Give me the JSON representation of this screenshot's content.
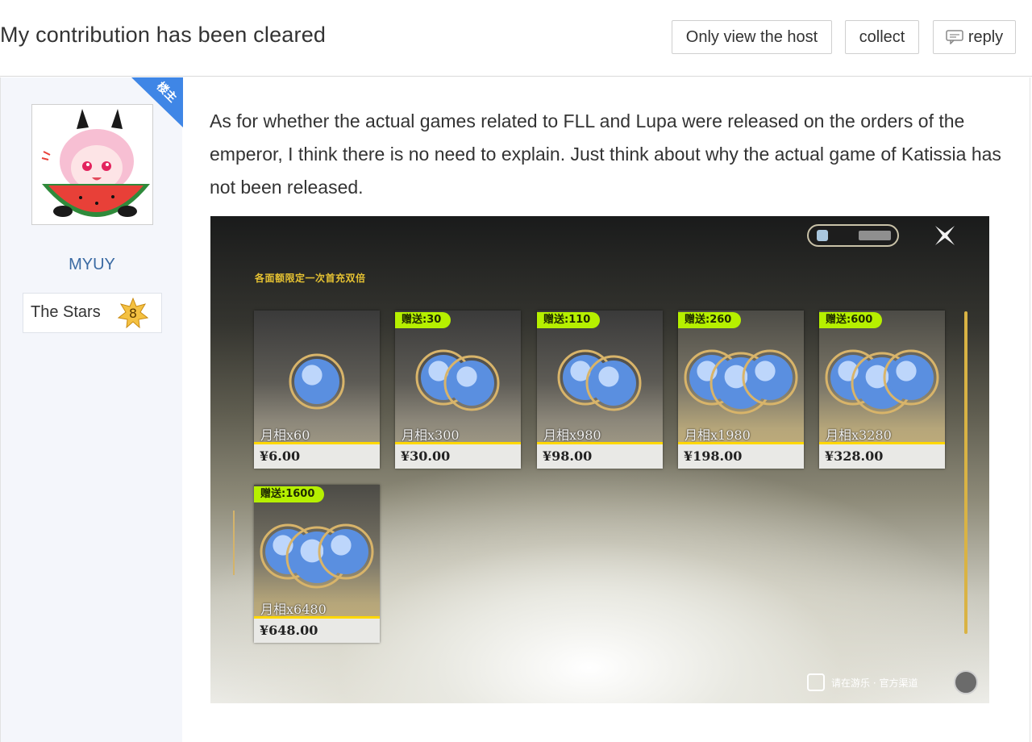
{
  "header": {
    "title": "My contribution has been cleared",
    "buttons": {
      "only_host": "Only view the host",
      "collect": "collect",
      "reply": "reply"
    }
  },
  "author": {
    "corner_badge": "楼主",
    "username": "MYUY",
    "level_title": "The Stars",
    "level": "8"
  },
  "post": {
    "text": "As for whether the actual games related to FLL and Lupa were released on the orders of the emperor, I think there is no need to explain. Just think about why the actual game of Katissia has not been released."
  },
  "screenshot": {
    "banner": "各面额限定一次首充双倍",
    "footer_text": "请在游乐 · 官方渠道",
    "cards": [
      {
        "gift": "",
        "name": "月相x60",
        "price": "¥6.00"
      },
      {
        "gift": "赠送:30",
        "name": "月相x300",
        "price": "¥30.00"
      },
      {
        "gift": "赠送:110",
        "name": "月相x980",
        "price": "¥98.00"
      },
      {
        "gift": "赠送:260",
        "name": "月相x1980",
        "price": "¥198.00"
      },
      {
        "gift": "赠送:600",
        "name": "月相x3280",
        "price": "¥328.00"
      },
      {
        "gift": "赠送:1600",
        "name": "月相x6480",
        "price": "¥648.00"
      }
    ]
  },
  "colors": {
    "username": "#3a6aa3",
    "corner": "#3f86e6",
    "gift_tag": "#b6f000",
    "price_bar": "#ffd800"
  }
}
